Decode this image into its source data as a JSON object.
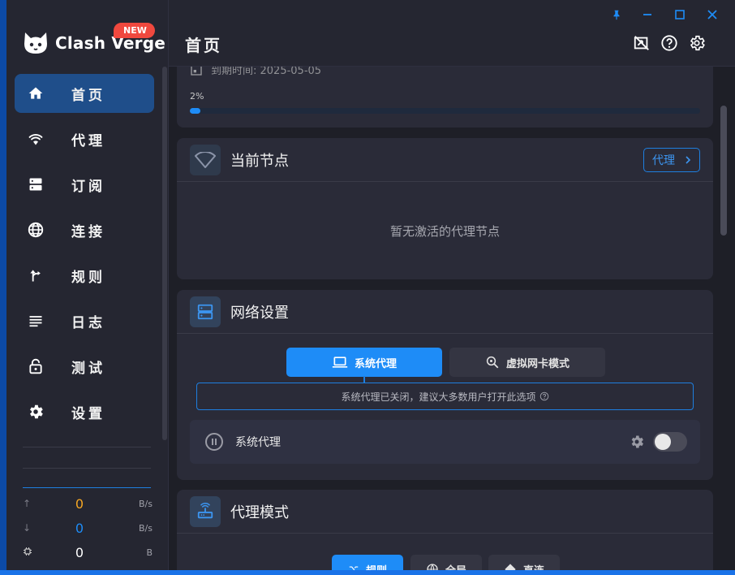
{
  "app": {
    "name": "Clash Verge",
    "badge": "NEW"
  },
  "header": {
    "title": "首页"
  },
  "sidebar": {
    "items": [
      {
        "label": "首页",
        "icon": "home-icon",
        "active": true
      },
      {
        "label": "代理",
        "icon": "wifi-icon",
        "active": false
      },
      {
        "label": "订阅",
        "icon": "dns-icon",
        "active": false
      },
      {
        "label": "连接",
        "icon": "globe-icon",
        "active": false
      },
      {
        "label": "规则",
        "icon": "fork-icon",
        "active": false
      },
      {
        "label": "日志",
        "icon": "list-icon",
        "active": false
      },
      {
        "label": "测试",
        "icon": "lock-icon",
        "active": false
      },
      {
        "label": "设置",
        "icon": "gear-icon",
        "active": false
      }
    ]
  },
  "traffic": {
    "upload": {
      "value": "0",
      "unit": "B/s",
      "color": "#f5a623"
    },
    "download": {
      "value": "0",
      "unit": "B/s",
      "color": "#1e8cf7"
    },
    "memory": {
      "value": "0",
      "unit": "B",
      "color": "#ffffff"
    }
  },
  "subscription": {
    "expire": "到期时间: 2025-05-05",
    "progress_label": "2%",
    "progress": 0.02
  },
  "current_node": {
    "title": "当前节点",
    "button": "代理",
    "empty": "暂无激活的代理节点"
  },
  "network": {
    "title": "网络设置",
    "tabs": [
      {
        "label": "系统代理",
        "active": true
      },
      {
        "label": "虚拟网卡模式",
        "active": false
      }
    ],
    "hint": "系统代理已关闭，建议大多数用户打开此选项",
    "row_label": "系统代理",
    "enabled": false
  },
  "proxy_mode": {
    "title": "代理模式",
    "modes": [
      {
        "label": "规则",
        "active": true
      },
      {
        "label": "全局",
        "active": false
      },
      {
        "label": "直连",
        "active": false
      }
    ]
  },
  "colors": {
    "accent": "#1e8cf7",
    "active_nav": "#1f4e8a"
  }
}
